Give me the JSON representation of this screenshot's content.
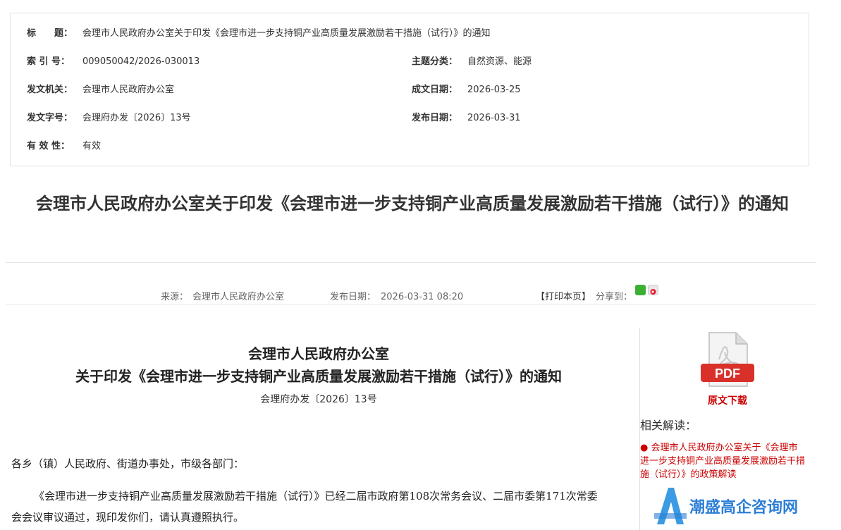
{
  "meta": {
    "title_label": "标　　题：",
    "title_value": "会理市人民政府办公室关于印发《会理市进一步支持铜产业高质量发展激励若干措施（试行）》的通知",
    "index_label": "索 引 号：",
    "index_value": "009050042/2026-030013",
    "topic_label": "主题分类：",
    "topic_value": "自然资源、能源",
    "issuer_label": "发文机关：",
    "issuer_value": "会理市人民政府办公室",
    "created_label": "成文日期：",
    "created_value": "2026-03-25",
    "docno_label": "发文字号：",
    "docno_value": "会理府办发〔2026〕13号",
    "published_label": "发布日期：",
    "published_value": "2026-03-31",
    "validity_label": "有 效 性：",
    "validity_value": "有效"
  },
  "article": {
    "title": "会理市人民政府办公室关于印发《会理市进一步支持铜产业高质量发展激励若干措施（试行）》的通知",
    "source_label": "来源：",
    "source_value": "会理市人民政府办公室",
    "date_label": "发布日期：",
    "date_value": "2026-03-31 08:20",
    "print_label": "【打印本页】",
    "share_label": "分享到："
  },
  "document": {
    "heading_line1": "会理市人民政府办公室",
    "heading_line2": "关于印发《会理市进一步支持铜产业高质量发展激励若干措施（试行）》的通知",
    "doc_number": "会理府办发〔2026〕13号",
    "salutation": "各乡（镇）人民政府、街道办事处，市级各部门：",
    "paragraph1_line1": "《会理市进一步支持铜产业高质量发展激励若干措施（试行）》已经二届市政府第108次常务会议、二届市委第171次常委",
    "paragraph1_line2": "会会议审议通过，现印发你们，请认真遵照执行。"
  },
  "sidebar": {
    "pdf_badge": "PDF",
    "download_label": "原文下载",
    "related_title": "相关解读：",
    "related_link": "● 会理市人民政府办公室关于《会理市进一步支持铜产业高质量发展激励若干措施（试行）》的政策解读"
  },
  "watermark": {
    "text": "潮盛高企咨询网"
  },
  "colors": {
    "link_red": "#cc0000",
    "pdf_red": "#d9302a",
    "wechat_green": "#3cb034",
    "watermark_blue": "#2d7fd6"
  }
}
